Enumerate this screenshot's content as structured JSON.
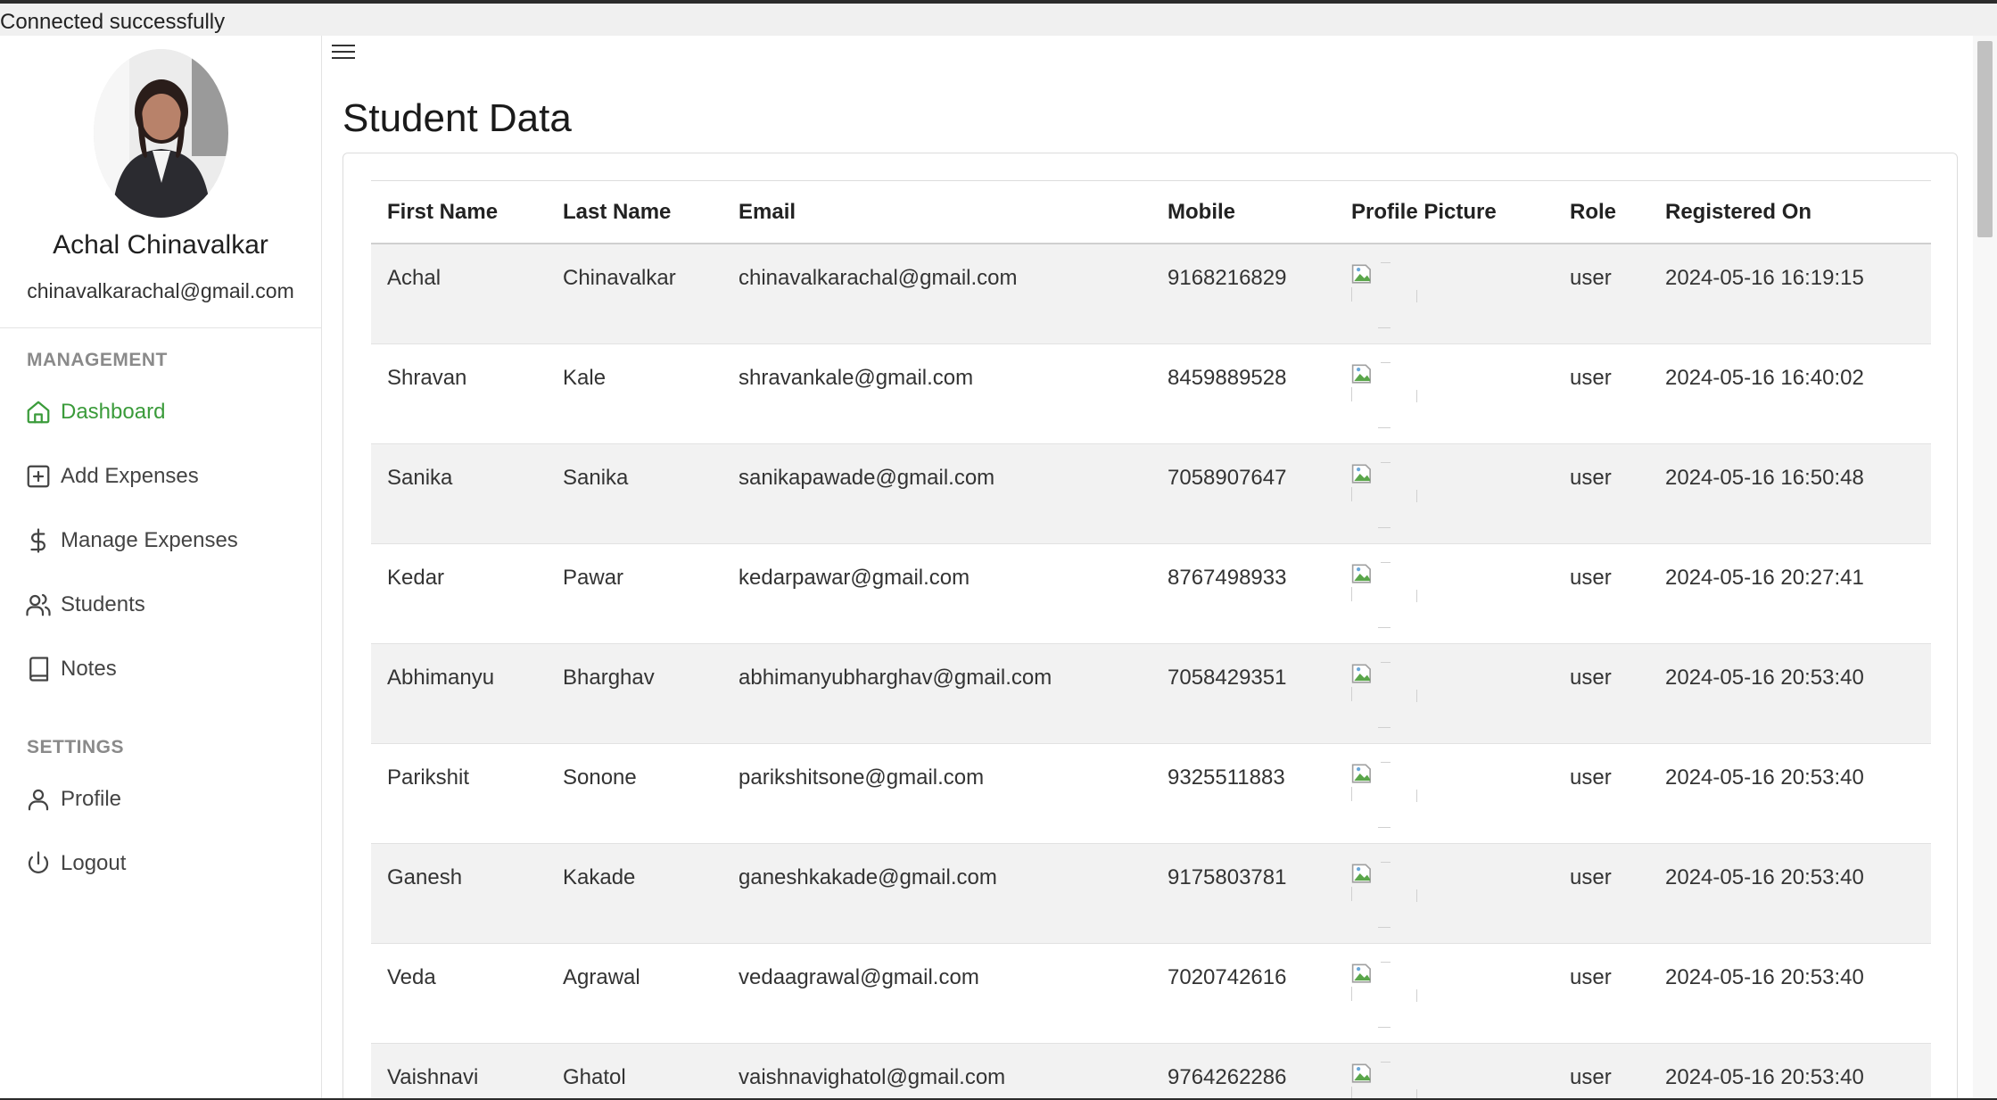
{
  "status_message": "Connected successfully",
  "sidebar": {
    "user_name": "Achal Chinavalkar",
    "user_email": "chinavalkarachal@gmail.com",
    "sections": [
      {
        "heading": "MANAGEMENT"
      },
      {
        "heading": "SETTINGS"
      }
    ],
    "items": [
      {
        "label": "Dashboard",
        "icon": "home-icon"
      },
      {
        "label": "Add Expenses",
        "icon": "plus-square-icon"
      },
      {
        "label": "Manage Expenses",
        "icon": "dollar-icon"
      },
      {
        "label": "Students",
        "icon": "users-icon"
      },
      {
        "label": "Notes",
        "icon": "book-icon"
      },
      {
        "label": "Profile",
        "icon": "user-icon"
      },
      {
        "label": "Logout",
        "icon": "power-icon"
      }
    ],
    "active_color": "#3a9b3a"
  },
  "main": {
    "title": "Student Data",
    "table": {
      "columns": [
        "First Name",
        "Last Name",
        "Email",
        "Mobile",
        "Profile Picture",
        "Role",
        "Registered On"
      ],
      "rows": [
        {
          "first": "Achal",
          "last": "Chinavalkar",
          "email": "chinavalkarachal@gmail.com",
          "mobile": "9168216829",
          "role": "user",
          "registered": "2024-05-16 16:19:15"
        },
        {
          "first": "Shravan",
          "last": "Kale",
          "email": "shravankale@gmail.com",
          "mobile": "8459889528",
          "role": "user",
          "registered": "2024-05-16 16:40:02"
        },
        {
          "first": "Sanika",
          "last": "Sanika",
          "email": "sanikapawade@gmail.com",
          "mobile": "7058907647",
          "role": "user",
          "registered": "2024-05-16 16:50:48"
        },
        {
          "first": "Kedar",
          "last": "Pawar",
          "email": "kedarpawar@gmail.com",
          "mobile": "8767498933",
          "role": "user",
          "registered": "2024-05-16 20:27:41"
        },
        {
          "first": "Abhimanyu",
          "last": "Bharghav",
          "email": "abhimanyubharghav@gmail.com",
          "mobile": "7058429351",
          "role": "user",
          "registered": "2024-05-16 20:53:40"
        },
        {
          "first": "Parikshit",
          "last": "Sonone",
          "email": "parikshitsone@gmail.com",
          "mobile": "9325511883",
          "role": "user",
          "registered": "2024-05-16 20:53:40"
        },
        {
          "first": "Ganesh",
          "last": "Kakade",
          "email": "ganeshkakade@gmail.com",
          "mobile": "9175803781",
          "role": "user",
          "registered": "2024-05-16 20:53:40"
        },
        {
          "first": "Veda",
          "last": "Agrawal",
          "email": "vedaagrawal@gmail.com",
          "mobile": "7020742616",
          "role": "user",
          "registered": "2024-05-16 20:53:40"
        },
        {
          "first": "Vaishnavi",
          "last": "Ghatol",
          "email": "vaishnavighatol@gmail.com",
          "mobile": "9764262286",
          "role": "user",
          "registered": "2024-05-16 20:53:40"
        }
      ]
    }
  }
}
